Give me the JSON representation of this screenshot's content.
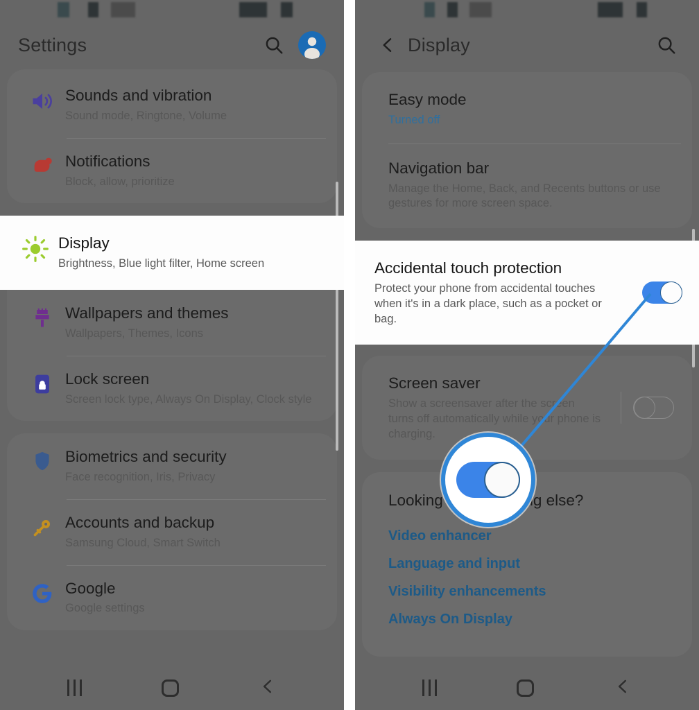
{
  "meta": {
    "accent_blue": "#3b84e8",
    "link_blue": "#1d5a87",
    "panel_bg": "#666666",
    "highlight_bg": "#fdfdfd"
  },
  "left_phone": {
    "appbar": {
      "title": "Settings",
      "search_icon": "search-icon",
      "avatar_icon": "account-avatar-icon"
    },
    "items": [
      {
        "icon": "volume-speaker-icon",
        "icon_color": "#4a3f9e",
        "title": "Sounds and vibration",
        "subtitle": "Sound mode, Ringtone, Volume",
        "highlighted": false
      },
      {
        "icon": "notifications-bell-icon",
        "icon_color": "#b83a33",
        "title": "Notifications",
        "subtitle": "Block, allow, prioritize",
        "highlighted": false
      },
      {
        "icon": "brightness-sun-icon",
        "icon_color": "#9bcc2e",
        "title": "Display",
        "subtitle": "Brightness, Blue light filter, Home screen",
        "highlighted": true
      },
      {
        "icon": "paint-brush-icon",
        "icon_color": "#6f2e8f",
        "title": "Wallpapers and themes",
        "subtitle": "Wallpapers, Themes, Icons",
        "highlighted": false
      },
      {
        "icon": "lock-screen-icon",
        "icon_color": "#3d3d9e",
        "title": "Lock screen",
        "subtitle": "Screen lock type, Always On Display, Clock style",
        "highlighted": false
      },
      {
        "icon": "shield-icon",
        "icon_color": "#3a5b8f",
        "title": "Biometrics and security",
        "subtitle": "Face recognition, Iris, Privacy",
        "highlighted": false
      },
      {
        "icon": "key-icon",
        "icon_color": "#c4901f",
        "title": "Accounts and backup",
        "subtitle": "Samsung Cloud, Smart Switch",
        "highlighted": false
      },
      {
        "icon": "google-g-icon",
        "icon_color": "#2f62c4",
        "title": "Google",
        "subtitle": "Google settings",
        "highlighted": false
      }
    ],
    "navbar": {
      "recents": "recents-icon",
      "home": "home-icon",
      "back": "back-icon"
    }
  },
  "right_phone": {
    "appbar": {
      "back_icon": "back-chevron-icon",
      "title": "Display",
      "search_icon": "search-icon"
    },
    "items": [
      {
        "title": "Easy mode",
        "subtitle": "Turned off",
        "subtitle_is_link": true,
        "toggle": null,
        "highlighted": false
      },
      {
        "title": "Navigation bar",
        "subtitle": "Manage the Home, Back, and Recents buttons or use gestures for more screen space.",
        "subtitle_is_link": false,
        "toggle": null,
        "highlighted": false
      },
      {
        "title": "Accidental touch protection",
        "subtitle": "Protect your phone from accidental touches when it's in a dark place, such as a pocket or bag.",
        "subtitle_is_link": false,
        "toggle": "on",
        "highlighted": true
      },
      {
        "title": "Screen saver",
        "subtitle": "Show a screensaver after the screen turns off automatically while your phone is charging.",
        "subtitle_is_link": false,
        "toggle": "off",
        "highlighted": false
      }
    ],
    "looking_for": {
      "title": "Looking for something else?",
      "links": [
        "Video enhancer",
        "Language and input",
        "Visibility enhancements",
        "Always On Display"
      ]
    },
    "navbar": {
      "recents": "recents-icon",
      "home": "home-icon",
      "back": "back-icon"
    },
    "callout": {
      "name": "magnified-toggle-callout",
      "state": "on"
    }
  }
}
